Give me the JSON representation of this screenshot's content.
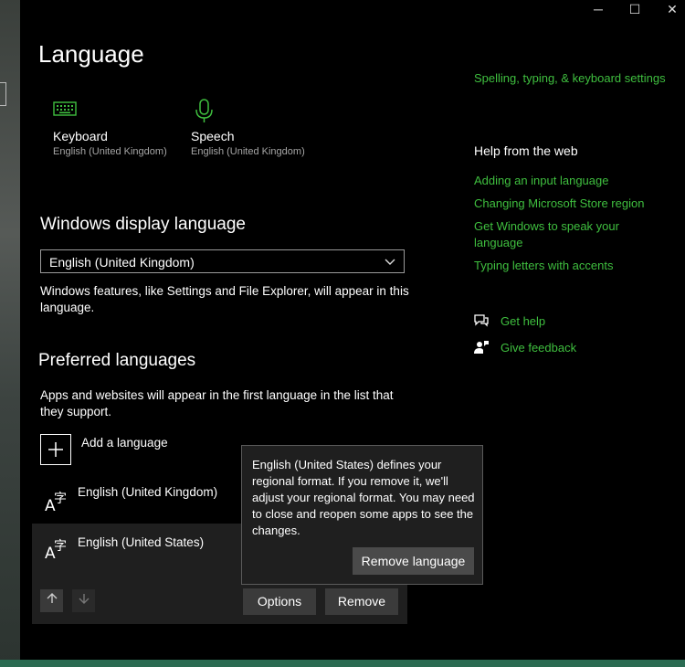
{
  "window": {
    "minimize": "─",
    "maximize": "☐",
    "close": "✕"
  },
  "title": "Language",
  "tiles": [
    {
      "label": "Keyboard",
      "sub": "English (United Kingdom)",
      "icon": "keyboard-icon"
    },
    {
      "label": "Speech",
      "sub": "English (United Kingdom)",
      "icon": "microphone-icon"
    }
  ],
  "display": {
    "heading": "Windows display language",
    "selected": "English (United Kingdom)",
    "desc": "Windows features, like Settings and File Explorer, will appear in this language."
  },
  "preferred": {
    "heading": "Preferred languages",
    "desc": "Apps and websites will appear in the first language in the list that they support.",
    "add_label": "Add a language",
    "languages": [
      "English (United Kingdom)",
      "English (United States)"
    ],
    "options_label": "Options",
    "remove_label": "Remove"
  },
  "tooltip": {
    "message": "English (United States) defines your regional format. If you remove it, we'll adjust your regional format. You may need to close and reopen some apps to see the changes.",
    "button": "Remove language"
  },
  "sidebar": {
    "related_link": "Spelling, typing, & keyboard settings",
    "help_heading": "Help from the web",
    "help_links": [
      "Adding an input language",
      "Changing Microsoft Store region",
      "Get Windows to speak your language",
      "Typing letters with accents"
    ],
    "get_help": "Get help",
    "give_feedback": "Give feedback"
  },
  "colors": {
    "accent": "#3fbf3f",
    "background": "#000000"
  }
}
